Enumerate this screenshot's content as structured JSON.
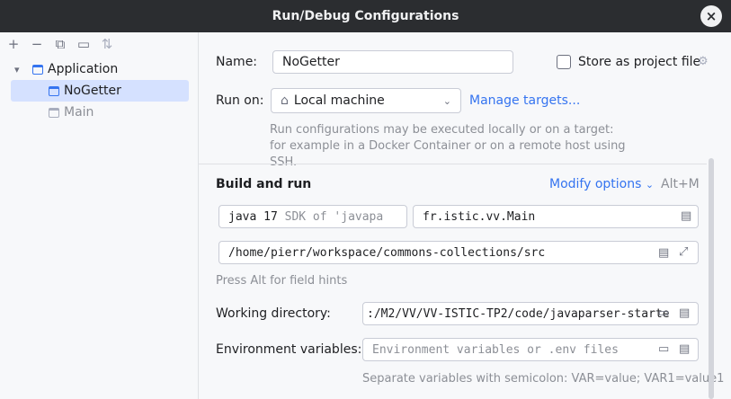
{
  "window": {
    "title": "Run/Debug Configurations",
    "close_icon": "×"
  },
  "toolbar": {
    "add": "+",
    "remove": "−",
    "copy": "⧉",
    "folder": "▭",
    "sort": "⇅"
  },
  "tree": {
    "group": "Application",
    "items": [
      {
        "label": "NoGetter",
        "selected": true
      },
      {
        "label": "Main",
        "selected": false
      }
    ]
  },
  "form": {
    "name_label": "Name:",
    "name_value": "NoGetter",
    "store_label": "Store as project file",
    "run_on_label": "Run on:",
    "run_on_value": "Local machine",
    "manage_targets": "Manage targets...",
    "run_on_hint": "Run configurations may be executed locally or on a target: for example in a Docker Container or on a remote host using SSH.",
    "build_run_title": "Build and run",
    "modify_options": "Modify options",
    "modify_shortcut": "Alt+M",
    "jdk_value": "java 17",
    "jdk_suffix": "SDK of 'javapa",
    "main_class": "fr.istic.vv.Main",
    "classpath": "/home/pierr/workspace/commons-collections/src",
    "field_hint": "Press Alt for field hints",
    "workdir_label": "Working directory:",
    "workdir_value": ":/M2/VV/VV-ISTIC-TP2/code/javaparser-starte",
    "env_label": "Environment variables:",
    "env_placeholder": "Environment variables or .env files",
    "env_hint": "Separate variables with semicolon: VAR=value; VAR1=value1"
  }
}
